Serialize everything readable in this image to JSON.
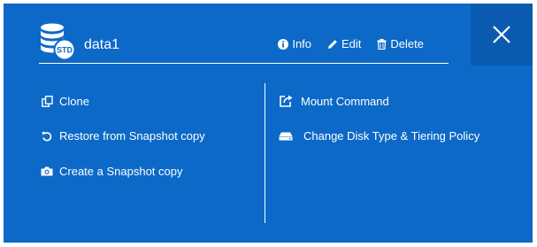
{
  "volume": {
    "name": "data1",
    "badge": "STD"
  },
  "header_actions": [
    {
      "label": "Info",
      "icon": "info-icon"
    },
    {
      "label": "Edit",
      "icon": "pencil-icon"
    },
    {
      "label": "Delete",
      "icon": "trash-icon"
    }
  ],
  "left_menu": [
    {
      "label": "Clone",
      "icon": "clone-icon"
    },
    {
      "label": "Restore from Snapshot copy",
      "icon": "restore-icon"
    },
    {
      "label": "Create a Snapshot copy",
      "icon": "camera-icon"
    }
  ],
  "right_menu": [
    {
      "label": "Mount Command",
      "icon": "mount-icon"
    },
    {
      "label": "Change Disk Type & Tiering Policy",
      "icon": "disk-icon"
    }
  ],
  "colors": {
    "panel_bg": "#0c69c7",
    "close_bg": "#0a5bb0",
    "text": "#ffffff"
  }
}
